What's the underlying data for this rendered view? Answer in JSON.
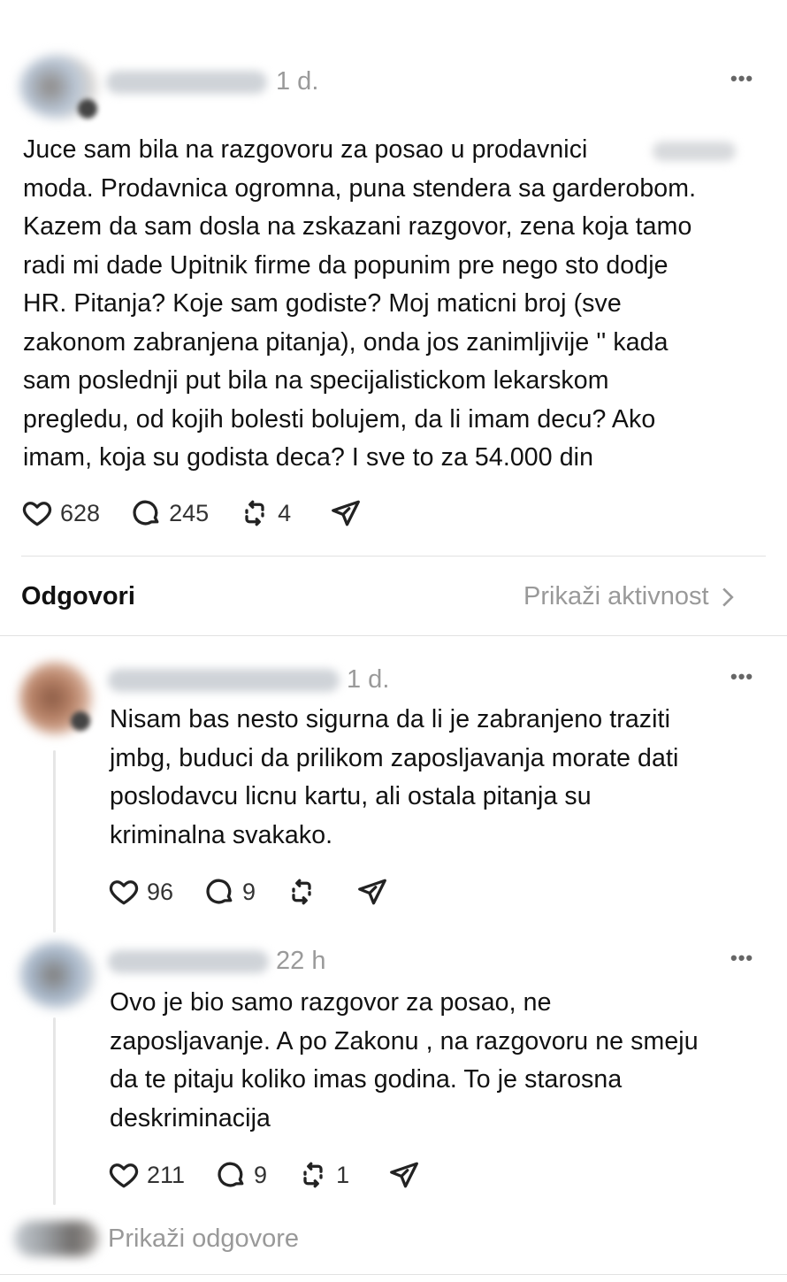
{
  "post": {
    "time": "1 d.",
    "more_icon": "more-horizontal-icon",
    "lines": [
      "Juce sam bila na razgovoru za posao u prodavnici",
      "moda. Prodavnica ogromna, puna stendera sa garderobom.",
      "Kazem da sam dosla na zskazani razgovor, zena koja tamo",
      "radi mi dade Upitnik firme da popunim pre nego sto dodje",
      "HR. Pitanja? Koje sam godiste? Moj maticni broj (sve",
      "zakonom zabranjena pitanja), onda jos  zanimljivije '' kada",
      "sam poslednji put bila na specijalistickom lekarskom",
      "pregledu, od kojih bolesti bolujem, da li imam decu? Ako",
      "imam, koja su godista deca? I sve to za 54.000 din"
    ],
    "likes": "628",
    "comments": "245",
    "reposts": "4"
  },
  "replies_header": {
    "label": "Odgovori",
    "activity_link": "Prikaži aktivnost"
  },
  "reply1": {
    "time": "1 d.",
    "lines": [
      "Nisam bas nesto sigurna da li je zabranjeno traziti",
      "jmbg, buduci da prilikom zaposljavanja morate dati",
      "poslodavcu licnu kartu, ali ostala pitanja su",
      "kriminalna svakako."
    ],
    "likes": "96",
    "comments": "9",
    "reposts": ""
  },
  "reply2": {
    "time": "22 h",
    "lines": [
      "Ovo je bio samo razgovor za posao, ne",
      "zaposljavanje. A po Zakonu , na razgovoru ne smeju",
      "da te pitaju koliko imas godina. To je starosna",
      "deskriminacija"
    ],
    "likes": "211",
    "comments": "9",
    "reposts": "1"
  },
  "show_replies": "Prikaži odgovore",
  "icons": {
    "like": "heart-icon",
    "comment": "comment-bubble-icon",
    "repost": "repost-icon",
    "share": "send-icon",
    "chevron": "chevron-right-icon"
  }
}
